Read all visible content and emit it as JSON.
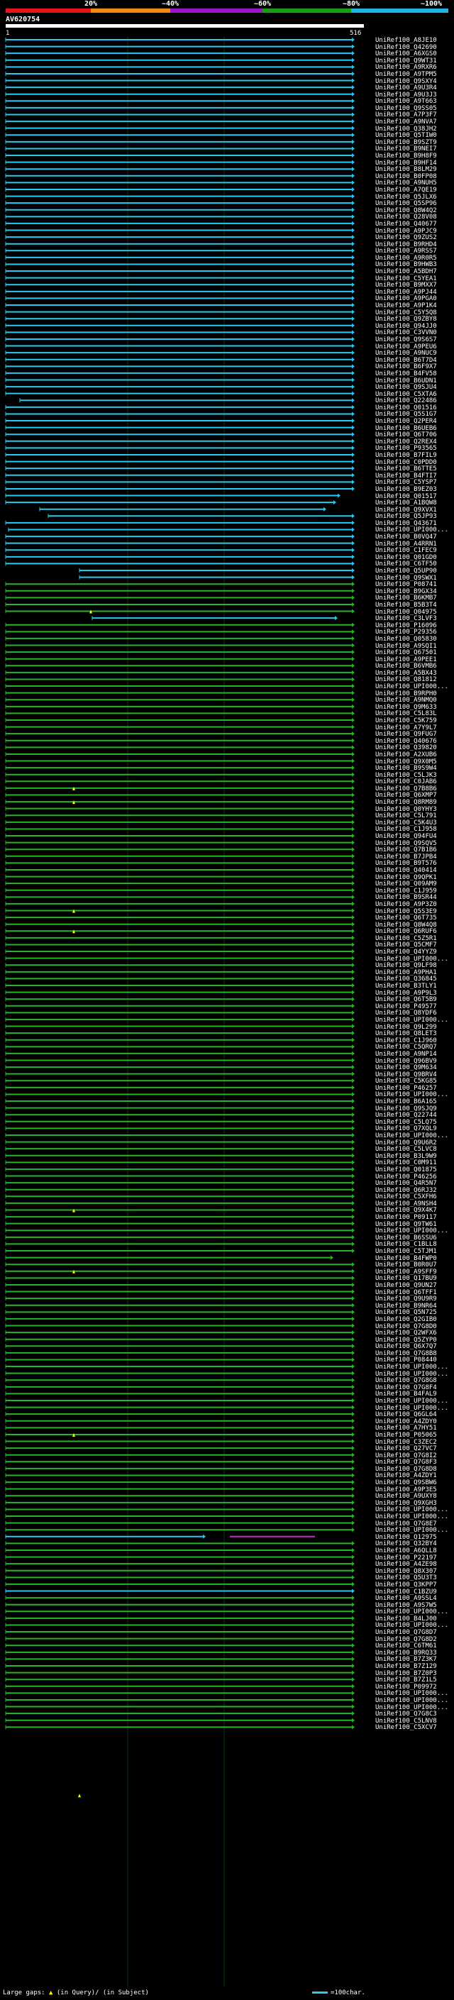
{
  "scale": {
    "labels": [
      "20%",
      "~40%",
      "~60%",
      "~80%",
      "~100%"
    ],
    "colors": [
      "#e8141a",
      "#f08a14",
      "#9e14c8",
      "#14a014",
      "#1eb4e6"
    ]
  },
  "query": {
    "name": "AV620754",
    "start": "1",
    "end": "516"
  },
  "colors": {
    "cyan": "#28c8f0",
    "green": "#28b428",
    "magenta": "#c828c8",
    "gap_marker": "#ffff00"
  },
  "hits": [
    "UniRef100_A8JE10",
    "UniRef100_Q42690",
    "UniRef100_A6XGS0",
    "UniRef100_Q9WT31",
    "UniRef100_A9RXR6",
    "UniRef100_A9TPM5",
    "UniRef100_Q9SXY4",
    "UniRef100_A9U3R4",
    "UniRef100_A9U3J3",
    "UniRef100_A9T663",
    "UniRef100_Q9SS05",
    "UniRef100_A7P3F7",
    "UniRef100_A9NVA7",
    "UniRef100_Q38JH2",
    "UniRef100_Q5TIW0",
    "UniRef100_B9SZT9",
    "UniRef100_B9NEI7",
    "UniRef100_B9H8F9",
    "UniRef100_B9HF14",
    "UniRef100_B8LM29",
    "UniRef100_B0FP08",
    "UniRef100_A9NUH5",
    "UniRef100_A7QE19",
    "UniRef100_Q5JLX6",
    "UniRef100_Q5SP96",
    "UniRef100_Q8W4Q2",
    "UniRef100_Q28V08",
    "UniRef100_Q40677",
    "UniRef100_A9PJC9",
    "UniRef100_Q9ZUS2",
    "UniRef100_B9RHD4",
    "UniRef100_A9RSS7",
    "UniRef100_A9R0R5",
    "UniRef100_B9HWB3",
    "UniRef100_A5BDH7",
    "UniRef100_C5YEA1",
    "UniRef100_B9MXX7",
    "UniRef100_A9PJ44",
    "UniRef100_A9PGA0",
    "UniRef100_A9P1K4",
    "UniRef100_C5Y5Q8",
    "UniRef100_Q9ZBY8",
    "UniRef100_Q94JJ0",
    "UniRef100_C3VVN0",
    "UniRef100_Q9S6S7",
    "UniRef100_A9PEU6",
    "UniRef100_A9NUC9",
    "UniRef100_B6T7D4",
    "UniRef100_B6F9X7",
    "UniRef100_B4FV58",
    "UniRef100_B6UDN1",
    "UniRef100_Q9SJU4",
    "UniRef100_C5XTA6",
    "UniRef100_Q22486",
    "UniRef100_Q01516",
    "UniRef100_Q5S1G7",
    "UniRef100_Q2PER4",
    "UniRef100_B6UEB6",
    "UniRef100_Q6T706",
    "UniRef100_Q2REX4",
    "UniRef100_P93565",
    "UniRef100_B7FIL9",
    "UniRef100_C0PDD0",
    "UniRef100_B6TTE5",
    "UniRef100_B4FTI7",
    "UniRef100_C5YSP7",
    "UniRef100_B9EZ03",
    "UniRef100_Q01517",
    "UniRef100_A1BQW8",
    "UniRef100_Q9XVX1",
    "UniRef100_Q5JP93",
    "UniRef100_Q43671",
    "UniRef100_UPI000...",
    "UniRef100_B0VQ47",
    "UniRef100_A4RRN1",
    "UniRef100_C1FEC9",
    "UniRef100_Q01GD0",
    "UniRef100_C6TF50",
    "UniRef100_Q5UP90",
    "UniRef100_Q9SWX1",
    "UniRef100_P08741",
    "UniRef100_B9GX34",
    "UniRef100_B6KMB7",
    "UniRef100_B5B3T4",
    "UniRef100_Q04975",
    "UniRef100_C3LVF3",
    "UniRef100_P16096",
    "UniRef100_P29356",
    "UniRef100_Q05830",
    "UniRef100_A9SQI1",
    "UniRef100_Q67501",
    "UniRef100_A9PEE1",
    "UniRef100_B6VMB6",
    "UniRef100_A5BX43",
    "UniRef100_Q81812",
    "UniRef100_UPI000...",
    "UniRef100_B9RPH0",
    "UniRef100_A9NMQ0",
    "UniRef100_Q9M633",
    "UniRef100_C5L83L",
    "UniRef100_C5K759",
    "UniRef100_A7Y9L7",
    "UniRef100_Q9FUG7",
    "UniRef100_Q40676",
    "UniRef100_Q39820",
    "UniRef100_A2XUB6",
    "UniRef100_Q9X0M5",
    "UniRef100_B9S9W4",
    "UniRef100_C5LJK3",
    "UniRef100_C0JAB6",
    "UniRef100_Q7B8B6",
    "UniRef100_Q6XMP7",
    "UniRef100_Q8RM89",
    "UniRef100_Q0YHY3",
    "UniRef100_C5L791",
    "UniRef100_C5K4U3",
    "UniRef100_C1J958",
    "UniRef100_Q94FU4",
    "UniRef100_Q9SQV5",
    "UniRef100_Q7B1B6",
    "UniRef100_B7JPB4",
    "UniRef100_B9T576",
    "UniRef100_Q40414",
    "UniRef100_Q9QPK1",
    "UniRef100_Q09AM9",
    "UniRef100_C1J959",
    "UniRef100_B9SR44",
    "UniRef100_A9P3Z0",
    "UniRef100_Q5S3E9",
    "UniRef100_Q6T735",
    "UniRef100_Q8W4Q8",
    "UniRef100_Q6RUF6",
    "UniRef100_C5Z5R1",
    "UniRef100_Q5CMF7",
    "UniRef100_Q4YYZ9",
    "UniRef100_UPI000...",
    "UniRef100_Q9LF98",
    "UniRef100_A9PHA1",
    "UniRef100_Q36845",
    "UniRef100_B3TLY1",
    "UniRef100_A9P9L3",
    "UniRef100_Q6T5B9",
    "UniRef100_P49577",
    "UniRef100_Q8YDF6",
    "UniRef100_UPI000...",
    "UniRef100_Q9L299",
    "UniRef100_Q8LET3",
    "UniRef100_C1J960",
    "UniRef100_C5QRQ7",
    "UniRef100_A9NP14",
    "UniRef100_Q96BV9",
    "UniRef100_Q9M634",
    "UniRef100_Q9BRV4",
    "UniRef100_C5KG85",
    "UniRef100_P46257",
    "UniRef100_UPI000...",
    "UniRef100_B6A165",
    "UniRef100_Q9SJQ9",
    "UniRef100_Q22744",
    "UniRef100_C5LQ75",
    "UniRef100_Q7XQL9",
    "UniRef100_UPI000...",
    "UniRef100_Q9U6R2",
    "UniRef100_C5LVC8",
    "UniRef100_B3L9W9",
    "UniRef100_C0M911",
    "UniRef100_Q01875",
    "UniRef100_P46256",
    "UniRef100_Q4R5N7",
    "UniRef100_Q6RJ32",
    "UniRef100_C5XFH6",
    "UniRef100_A9NSH4",
    "UniRef100_Q9X4K7",
    "UniRef100_P09117",
    "UniRef100_Q9TW61",
    "UniRef100_UPI000...",
    "UniRef100_B6SSU6",
    "UniRef100_C1BLL8",
    "UniRef100_C5TJM1",
    "UniRef100_B4FWP0",
    "UniRef100_B0R0U7",
    "UniRef100_A9SFF9",
    "UniRef100_Q17BU9",
    "UniRef100_Q9UN27",
    "UniRef100_Q6TFF1",
    "UniRef100_Q9U9R9",
    "UniRef100_B9NR64",
    "UniRef100_Q5N725",
    "UniRef100_Q2GIB0",
    "UniRef100_Q7G8D0",
    "UniRef100_Q2WFX6",
    "UniRef100_Q5ZYP0",
    "UniRef100_Q6X7Q7",
    "UniRef100_Q7G8B8",
    "UniRef100_P08440",
    "UniRef100_UPI000...",
    "UniRef100_UPI000...",
    "UniRef100_Q7G8G8",
    "UniRef100_Q7G8F4",
    "UniRef100_B4FAL9",
    "UniRef100_UPI000...",
    "UniRef100_UPI000...",
    "UniRef100_Q6GL64",
    "UniRef100_A4ZDY0",
    "UniRef100_A7HY51",
    "UniRef100_P05065",
    "UniRef100_C3ZEC2",
    "UniRef100_Q27VC7",
    "UniRef100_Q7G8I2",
    "UniRef100_Q7G8F3",
    "UniRef100_Q7G8D8",
    "UniRef100_A4ZDY1",
    "UniRef100_Q9SBW6",
    "UniRef100_A9P3E5",
    "UniRef100_A9UXY8",
    "UniRef100_Q9XGH3",
    "UniRef100_UPI000...",
    "UniRef100_UPI000...",
    "UniRef100_Q7G8E7",
    "UniRef100_UPI000...",
    "UniRef100_Q12975",
    "UniRef100_Q32BY4",
    "UniRef100_A6QLL8",
    "UniRef100_P22197",
    "UniRef100_A4ZE98",
    "UniRef100_Q8X307",
    "UniRef100_Q5U3T3",
    "UniRef100_Q3KPP7",
    "UniRef100_C1BZU9",
    "UniRef100_A9SSL4",
    "UniRef100_A9S7W5",
    "UniRef100_UPI000...",
    "UniRef100_B4LJ00",
    "UniRef100_UPI000...",
    "UniRef100_Q7G8D7",
    "UniRef100_Q7G8D2",
    "UniRef100_C6TM61",
    "UniRef100_B9RQ33",
    "UniRef100_B7Z3K7",
    "UniRef100_B7Z129",
    "UniRef100_B7Z0P3",
    "UniRef100_B7Z1L5",
    "UniRef100_P09972",
    "UniRef100_UPI000...",
    "UniRef100_UPI000...",
    "UniRef100_UPI000...",
    "UniRef100_Q7G8C3",
    "UniRef100_C5LNV8",
    "UniRef100_C5XCV7"
  ],
  "legend": {
    "gaps_prefix": "Large gaps:",
    "gaps_query": "(in Query)",
    "gaps_sep": "/",
    "gaps_subject": "(in Subject)",
    "scale_text": "=100char."
  }
}
